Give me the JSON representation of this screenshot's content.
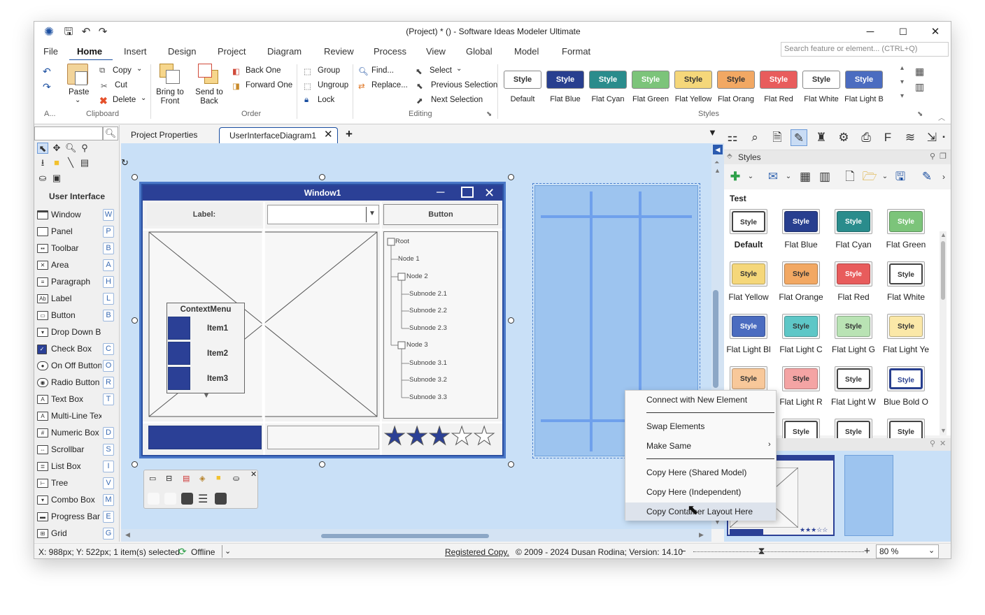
{
  "titlebar": {
    "title": "(Project) *  ()  - Software Ideas Modeler Ultimate"
  },
  "menu": {
    "items": [
      "File",
      "Home",
      "Insert",
      "Design",
      "Project",
      "Diagram",
      "Review",
      "Process",
      "View",
      "Global",
      "Model",
      "Format"
    ],
    "active": "Home",
    "search_placeholder": "Search feature or element... (CTRL+Q)"
  },
  "ribbon": {
    "clipboard": {
      "label": "Clipboard",
      "paste": "Paste",
      "copy": "Copy",
      "cut": "Cut",
      "delete": "Delete",
      "extra": "A..."
    },
    "order": {
      "label": "Order",
      "bring_to_front": "Bring to Front",
      "send_to_back": "Send to Back",
      "back_one": "Back One",
      "forward_one": "Forward One"
    },
    "group": {
      "group": "Group",
      "ungroup": "Ungroup",
      "lock": "Lock"
    },
    "editing": {
      "label": "Editing",
      "find": "Find...",
      "replace": "Replace...",
      "select": "Select",
      "previous_selection": "Previous Selection",
      "next_selection": "Next Selection"
    },
    "styles": {
      "label": "Styles",
      "button_text": "Style",
      "items": [
        {
          "name": "Default",
          "bg": "#ffffff",
          "fg": "#333333"
        },
        {
          "name": "Flat Blue",
          "bg": "#283f8f",
          "fg": "#ffffff"
        },
        {
          "name": "Flat Cyan",
          "bg": "#2a8c8c",
          "fg": "#ffffff"
        },
        {
          "name": "Flat Green",
          "bg": "#7cc47a",
          "fg": "#ffffff"
        },
        {
          "name": "Flat Yellow",
          "bg": "#f5d77a",
          "fg": "#333333"
        },
        {
          "name": "Flat Orang",
          "bg": "#f2a863",
          "fg": "#333333"
        },
        {
          "name": "Flat Red",
          "bg": "#e85c5c",
          "fg": "#ffffff"
        },
        {
          "name": "Flat White",
          "bg": "#ffffff",
          "fg": "#333333"
        },
        {
          "name": "Flat Light B",
          "bg": "#4b6cc0",
          "fg": "#ffffff"
        }
      ]
    }
  },
  "toolbox": {
    "header": "User Interface",
    "items": [
      {
        "label": "Window",
        "key": "W",
        "icon": "window-icon"
      },
      {
        "label": "Panel",
        "key": "P",
        "icon": "panel-icon"
      },
      {
        "label": "Toolbar",
        "key": "B",
        "icon": "toolbar-icon"
      },
      {
        "label": "Area",
        "key": "A",
        "icon": "area-icon"
      },
      {
        "label": "Paragraph",
        "key": "H",
        "icon": "paragraph-icon"
      },
      {
        "label": "Label",
        "key": "L",
        "icon": "label-icon"
      },
      {
        "label": "Button",
        "key": "B",
        "icon": "button-icon"
      },
      {
        "label": "Drop Down Butt...",
        "key": "",
        "icon": "dropdown-button-icon"
      },
      {
        "label": "Check Box",
        "key": "C",
        "icon": "checkbox-icon"
      },
      {
        "label": "On Off Button",
        "key": "O",
        "icon": "toggle-icon"
      },
      {
        "label": "Radio Button",
        "key": "R",
        "icon": "radio-icon"
      },
      {
        "label": "Text Box",
        "key": "T",
        "icon": "textbox-icon"
      },
      {
        "label": "Multi-Line Text B...",
        "key": "",
        "icon": "multiline-textbox-icon"
      },
      {
        "label": "Numeric Box",
        "key": "D",
        "icon": "numeric-box-icon"
      },
      {
        "label": "Scrollbar",
        "key": "S",
        "icon": "scrollbar-icon"
      },
      {
        "label": "List Box",
        "key": "I",
        "icon": "listbox-icon"
      },
      {
        "label": "Tree",
        "key": "V",
        "icon": "tree-icon"
      },
      {
        "label": "Combo Box",
        "key": "M",
        "icon": "combobox-icon"
      },
      {
        "label": "Progress Bar",
        "key": "E",
        "icon": "progressbar-icon"
      },
      {
        "label": "Grid",
        "key": "G",
        "icon": "grid-icon"
      }
    ]
  },
  "tabs": [
    {
      "label": "Project Properties",
      "active": false
    },
    {
      "label": "UserInterfaceDiagram1",
      "active": true
    }
  ],
  "diagram": {
    "window_title": "Window1",
    "label_text": "Label:",
    "button_text": "Button",
    "context_menu": {
      "title": "ContextMenu",
      "items": [
        "Item1",
        "Item2",
        "Item3"
      ]
    },
    "tree": [
      "Root",
      "Node 1",
      "Node 2",
      "Subnode 2.1",
      "Subnode 2.2",
      "Subnode 2.3",
      "Node 3",
      "Subnode 3.1",
      "Subnode 3.2",
      "Subnode 3.3"
    ],
    "rating": {
      "filled": 3,
      "total": 5
    }
  },
  "styles_panel": {
    "title": "Styles",
    "group": "Test",
    "button_text": "Style",
    "items": [
      {
        "name": "Default",
        "bg": "#ffffff",
        "fg": "#333333",
        "bold": true
      },
      {
        "name": "Flat Blue",
        "bg": "#283f8f",
        "fg": "#ffffff"
      },
      {
        "name": "Flat Cyan",
        "bg": "#2a8c8c",
        "fg": "#ffffff"
      },
      {
        "name": "Flat Green",
        "bg": "#7cc47a",
        "fg": "#ffffff"
      },
      {
        "name": "Flat Yellow",
        "bg": "#f5d77a",
        "fg": "#333333"
      },
      {
        "name": "Flat Orange",
        "bg": "#f2a863",
        "fg": "#333333"
      },
      {
        "name": "Flat Red",
        "bg": "#e85c5c",
        "fg": "#ffffff"
      },
      {
        "name": "Flat White",
        "bg": "#ffffff",
        "fg": "#333333"
      },
      {
        "name": "Flat Light Bl",
        "bg": "#4b6cc0",
        "fg": "#ffffff"
      },
      {
        "name": "Flat Light C",
        "bg": "#5ec7c7",
        "fg": "#333333"
      },
      {
        "name": "Flat Light G",
        "bg": "#b9e3b4",
        "fg": "#333333"
      },
      {
        "name": "Flat Light Ye",
        "bg": "#fbe8a8",
        "fg": "#333333"
      },
      {
        "name": "",
        "bg": "#f8c89a",
        "fg": "#333333"
      },
      {
        "name": "Flat Light R",
        "bg": "#f4a4a4",
        "fg": "#333333"
      },
      {
        "name": "Flat Light W",
        "bg": "#ffffff",
        "fg": "#333333"
      },
      {
        "name": "Blue Bold O",
        "bg": "#ffffff",
        "fg": "#283f8f"
      },
      {
        "name": "",
        "bg": "#ffffff",
        "fg": "#333333"
      },
      {
        "name": "",
        "bg": "#ffffff",
        "fg": "#333333"
      },
      {
        "name": "",
        "bg": "#ffffff",
        "fg": "#333333"
      },
      {
        "name": "",
        "bg": "#ffffff",
        "fg": "#333333"
      }
    ]
  },
  "context_menu": {
    "items": [
      {
        "label": "Connect with New Element",
        "underline": "C"
      },
      {
        "label": "Swap Elements",
        "underline": "S"
      },
      {
        "label": "Make Same",
        "underline": "M",
        "submenu": true
      },
      {
        "label": "Copy Here (Shared Model)",
        "underline": "S"
      },
      {
        "label": "Copy Here (Independent)",
        "underline": "I"
      },
      {
        "label": "Copy Container Layout Here",
        "underline": "L",
        "highlighted": true
      }
    ]
  },
  "status": {
    "position": "X: 988px; Y: 522px; 1 item(s) selected",
    "connection": "Offline",
    "registered": "Registered Copy.",
    "copyright": "© 2009 - 2024 Dusan Rodina; Version: 14.10",
    "zoom": "80 %",
    "zoom_level": 0.8
  },
  "colors": {
    "accent": "#1a4ea0",
    "canvas": "#c9e0f7",
    "wf_blue": "#2b4096"
  }
}
